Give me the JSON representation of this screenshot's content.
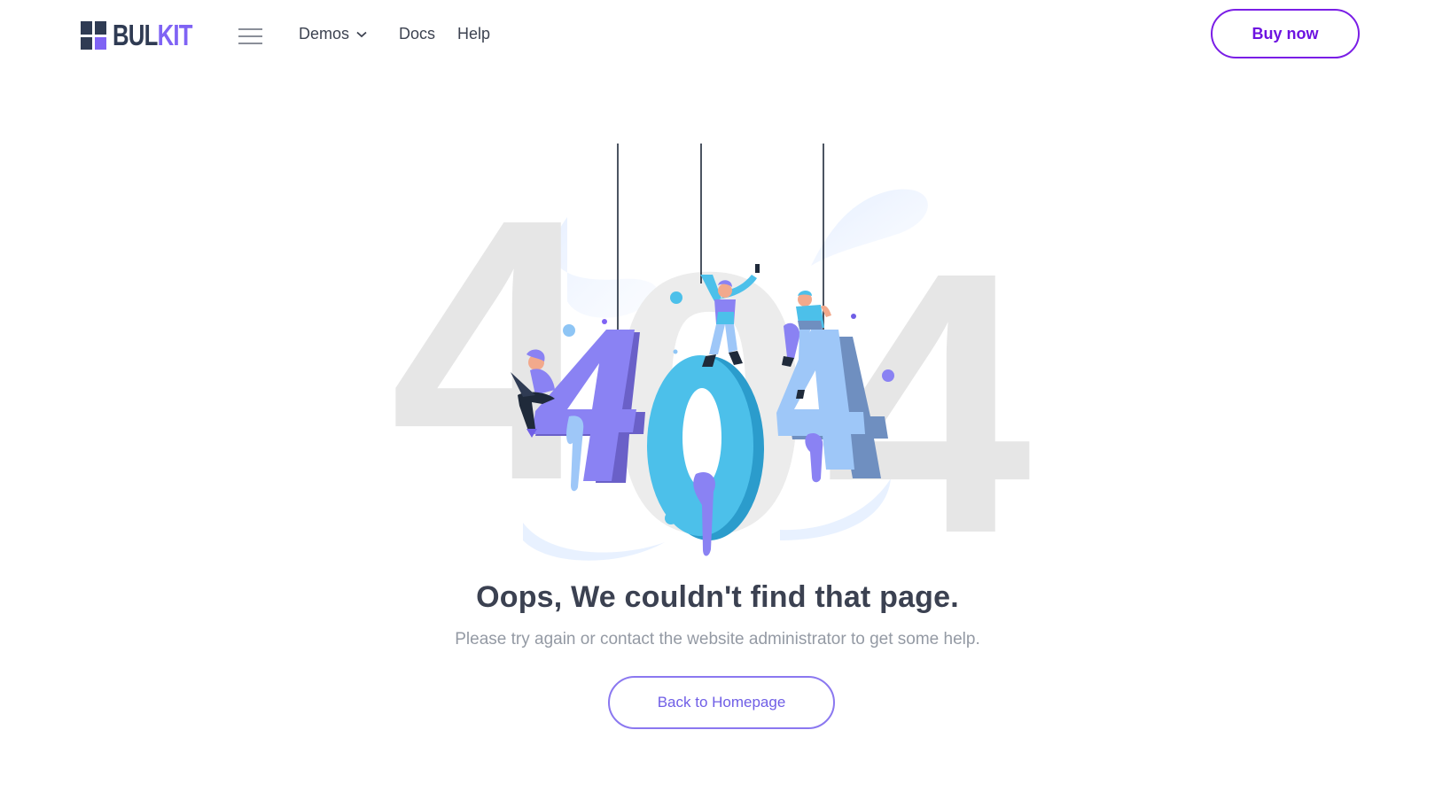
{
  "brand": {
    "name_part1": "BUL",
    "name_part2": "KIT"
  },
  "nav": {
    "menu_icon": "hamburger-menu-icon",
    "items": [
      {
        "label": "Demos",
        "has_dropdown": true,
        "icon": "chevron-down-icon"
      },
      {
        "label": "Docs"
      },
      {
        "label": "Help"
      }
    ],
    "cta_label": "Buy now"
  },
  "error": {
    "code_digits": [
      "4",
      "0",
      "4"
    ],
    "heading": "Oops, We couldn't find that page.",
    "message": "Please try again or contact the website administrator to get some help.",
    "button_label": "Back to Homepage"
  },
  "colors": {
    "brand_dark": "#2f3b53",
    "brand_purple": "#7f63f4",
    "cta_border": "#7a1ee6",
    "digit_purple": "#8a82f3",
    "digit_cyan": "#4cc0ea",
    "digit_blue": "#8eb6f0",
    "watermark_gray": "#e6e6e6"
  }
}
